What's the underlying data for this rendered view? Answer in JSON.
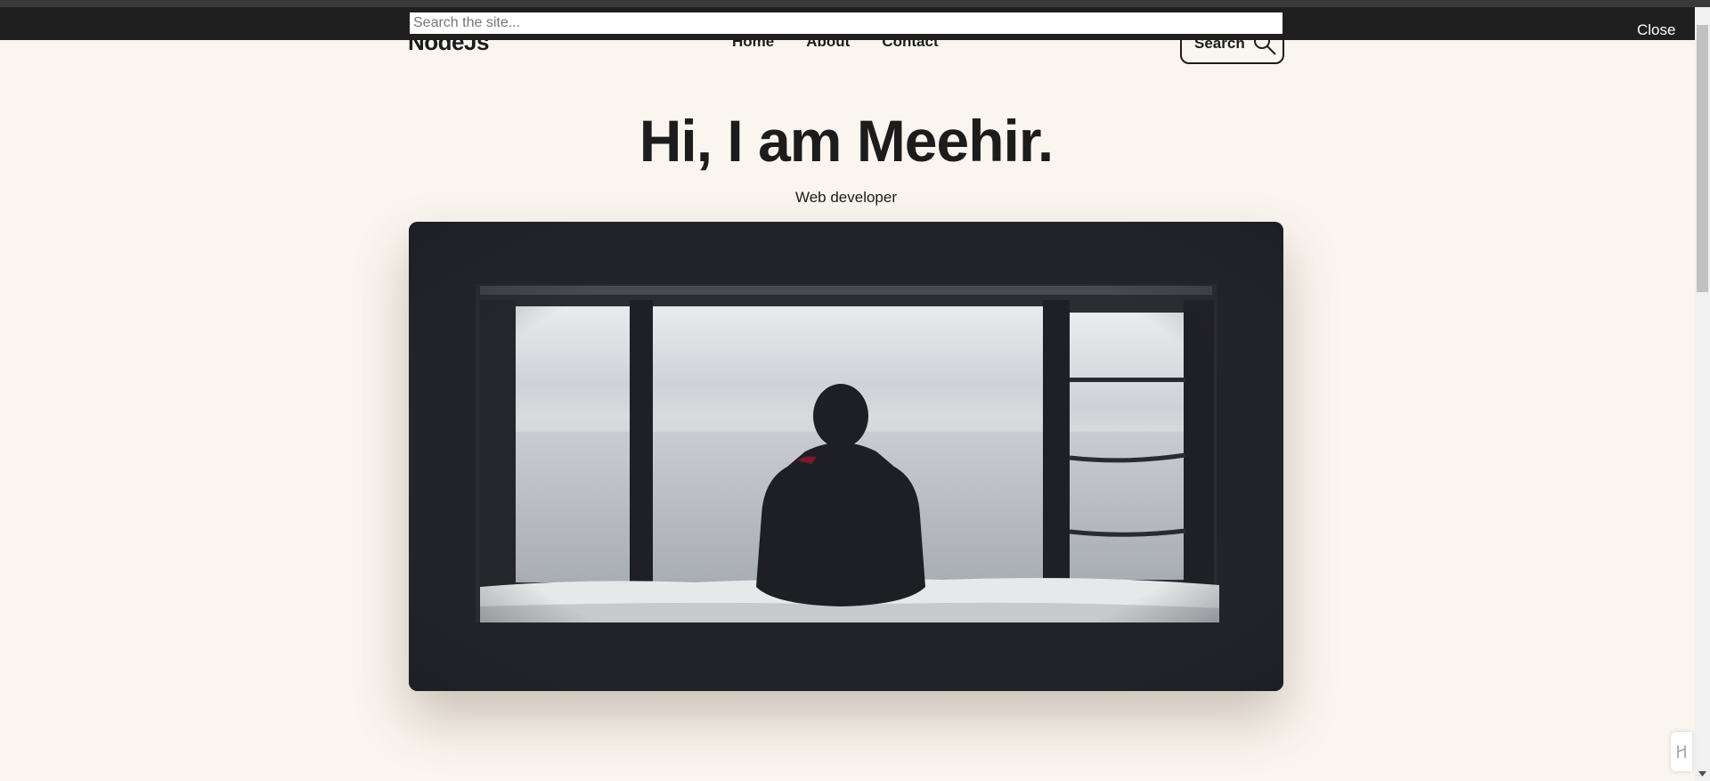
{
  "header": {
    "logo": "NodeJs",
    "nav": [
      {
        "label": "Home"
      },
      {
        "label": "About"
      },
      {
        "label": "Contact"
      }
    ],
    "search_button_label": "Search"
  },
  "search_overlay": {
    "placeholder": "Search the site...",
    "close_label": "Close"
  },
  "hero": {
    "title": "Hi, I am Meehir.",
    "subtitle": "Web developer"
  },
  "icons": {
    "search": "search-icon",
    "scroll_up": "chevron-up-icon",
    "scroll_down": "chevron-down-icon",
    "widget": "widget-icon"
  },
  "colors": {
    "background": "#faf5ef",
    "overlay": "#1f1f1f",
    "text": "#1c1c1c",
    "image_bg": "#23242b"
  }
}
